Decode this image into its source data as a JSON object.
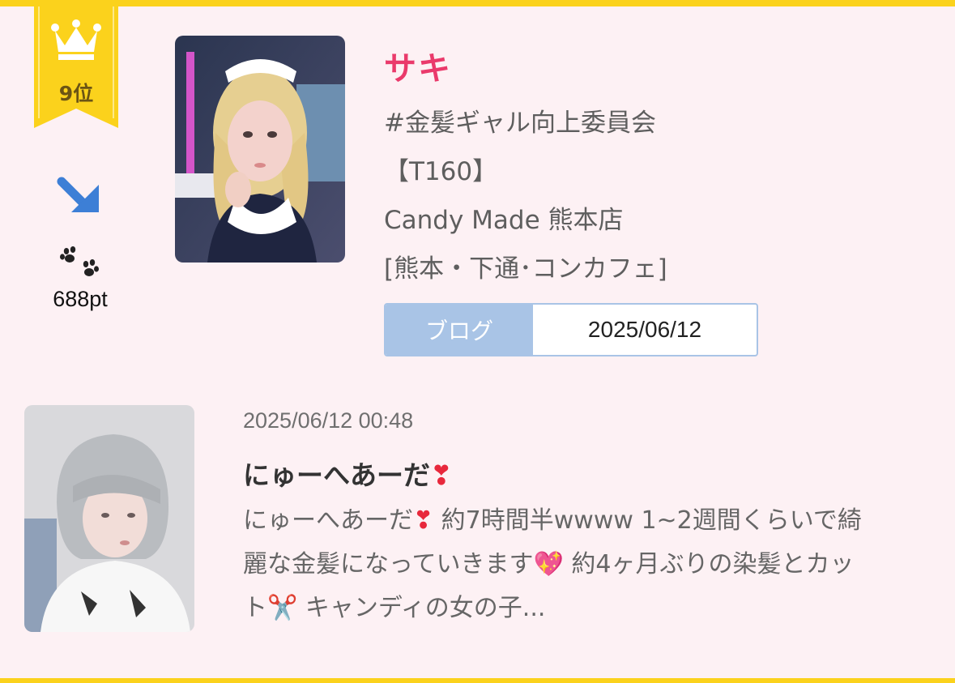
{
  "ranking": {
    "rank_label": "9位",
    "trend_icon": "arrow-down-right-icon",
    "points_icon": "paw-icon",
    "points": "688pt"
  },
  "profile": {
    "name": "サキ",
    "tag": "#金髪ギャル向上委員会",
    "height": "【T160】",
    "shop": "Candy Made 熊本店",
    "area": "[熊本・下通･コンカフェ]"
  },
  "blog_box": {
    "tab_label": "ブログ",
    "date": "2025/06/12"
  },
  "post": {
    "datetime": "2025/06/12 00:48",
    "title": "にゅーへあーだ",
    "title_emoji": "❣",
    "body_line1_a": "にゅーへあーだ",
    "body_line1_emoji": "❣",
    "body_line1_b": " 約7時間半wwww 1~2週間くらいで綺",
    "body_line2_a": "麗な金髪になっていきます",
    "body_line2_emoji": "💖",
    "body_line2_b": " 約4ヶ月ぶりの染髪とカッ",
    "body_line3_a": "ト",
    "body_line3_emoji": "✂️",
    "body_line3_b": " キャンディの女の子..."
  },
  "colors": {
    "accent_yellow": "#fbd21c",
    "name_pink": "#ea3a6b",
    "blog_blue": "#a9c4e6",
    "trend_blue": "#3d7fd6",
    "background": "#fdf1f4"
  }
}
